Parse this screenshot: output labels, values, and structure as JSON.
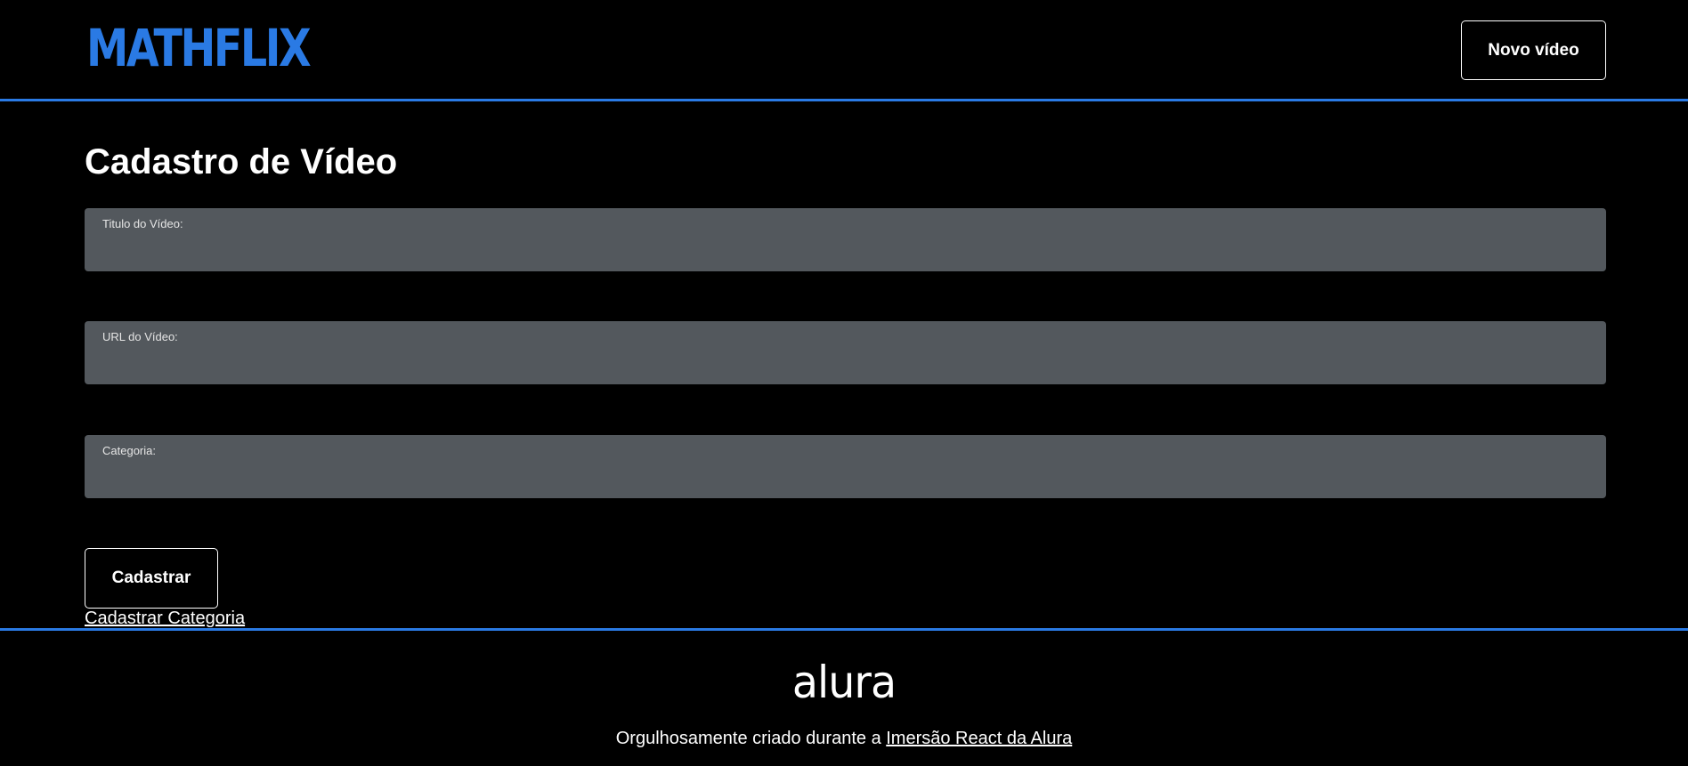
{
  "header": {
    "logo": "MATHFLIX",
    "new_video_button": "Novo vídeo"
  },
  "main": {
    "title": "Cadastro de Vídeo",
    "fields": [
      {
        "label": "Titulo do Vídeo:",
        "value": ""
      },
      {
        "label": "URL do Vídeo:",
        "value": ""
      },
      {
        "label": "Categoria:",
        "value": ""
      }
    ],
    "submit_button": "Cadastrar",
    "category_link": "Cadastrar Categoria"
  },
  "footer": {
    "logo": "alura",
    "text": "Orgulhosamente criado durante a ",
    "link": "Imersão React da Alura"
  },
  "colors": {
    "background": "#000000",
    "accent": "#2A7AE4",
    "field_background": "#53585D",
    "text": "#FFFFFF"
  }
}
